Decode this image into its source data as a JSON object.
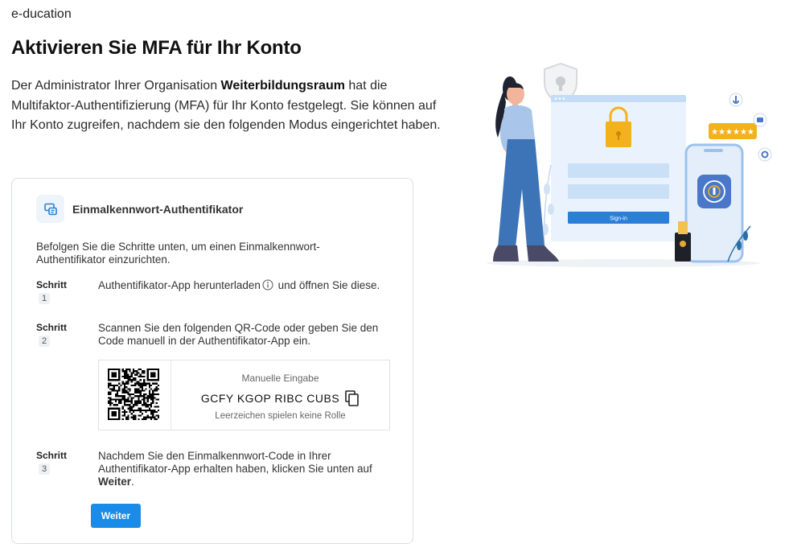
{
  "brand": "e-ducation",
  "page_title": "Aktivieren Sie MFA für Ihr Konto",
  "intro": {
    "before": "Der Administrator Ihrer Organisation ",
    "org_name": "Weiterbildungsraum",
    "after": " hat die Multifaktor-Authentifizierung (MFA) für Ihr Konto festgelegt. Sie können auf Ihr Konto zugreifen, nachdem sie den folgenden Modus eingerichtet haben."
  },
  "card": {
    "icon": "authenticator-app-icon",
    "title": "Einmalkennwort-Authentifikator",
    "description": "Befolgen Sie die Schritte unten, um einen Einmalkennwort-Authentifikator einzurichten."
  },
  "steps": [
    {
      "label": "Schritt",
      "number": "1",
      "text_before": "Authentifikator-App herunterladen",
      "text_after": " und öffnen Sie diese."
    },
    {
      "label": "Schritt",
      "number": "2",
      "text": "Scannen Sie den folgenden QR-Code oder geben Sie den Code manuell in der Authentifikator-App ein."
    },
    {
      "label": "Schritt",
      "number": "3",
      "text_before": "Nachdem Sie den Einmalkennwort-Code in Ihrer Authentifikator-App erhalten haben, klicken Sie unten auf ",
      "text_bold": "Weiter",
      "text_after": "."
    }
  ],
  "manual_entry": {
    "label": "Manuelle Eingabe",
    "code": "GCFY KGOP RIBC CUBS",
    "hint": "Leerzeichen spielen keine Rolle"
  },
  "illustration": {
    "signin_button": "Sign-in",
    "rating_stars": "★★★★★★"
  },
  "next_button": "Weiter",
  "colors": {
    "accent": "#1a8be8",
    "lock": "#f3b21c",
    "illustration_blue": "#4a77c9",
    "card_border": "#d9dde3"
  }
}
